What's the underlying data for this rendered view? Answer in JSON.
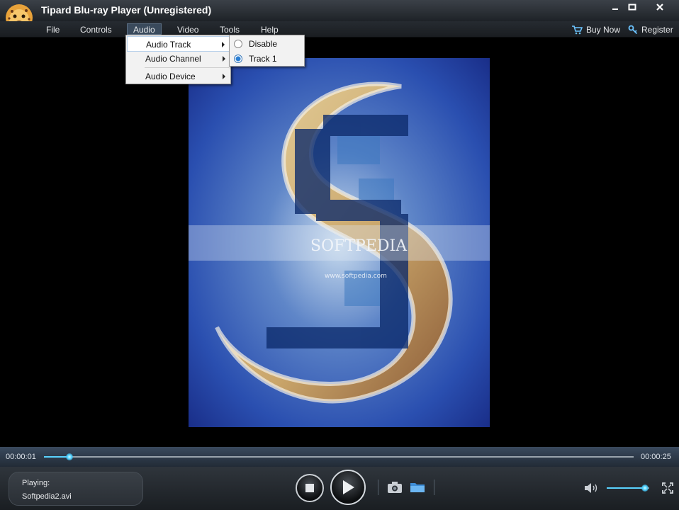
{
  "window": {
    "title": "Tipard Blu-ray Player (Unregistered)"
  },
  "menubar": {
    "items": [
      "File",
      "Controls",
      "Audio",
      "Video",
      "Tools",
      "Help"
    ],
    "active": "Audio",
    "buy_now": "Buy Now",
    "register": "Register"
  },
  "audio_menu": {
    "items": [
      "Audio Track",
      "Audio Channel",
      "Audio Device"
    ]
  },
  "audio_track_submenu": {
    "items": [
      {
        "label": "Disable",
        "selected": false
      },
      {
        "label": "Track 1",
        "selected": true
      }
    ]
  },
  "video": {
    "watermark": "SOFTPEDIA",
    "watermark_url": "www.softpedia.com"
  },
  "progress": {
    "current_time": "00:00:01",
    "total_time": "00:00:25",
    "fraction": 0.043
  },
  "now_playing": {
    "label": "Playing:",
    "file": "Softpedia2.avi"
  },
  "volume": {
    "fraction": 0.9
  },
  "colors": {
    "accent": "#4fd2ff",
    "menu_bg": "#f2f2f2",
    "titlebar": "#2b3036"
  },
  "icons": [
    "app-logo-icon",
    "minimize-icon",
    "maximize-icon",
    "close-icon",
    "cart-icon",
    "key-icon",
    "stop-icon",
    "play-icon",
    "camera-icon",
    "folder-icon",
    "speaker-icon",
    "fullscreen-icon"
  ]
}
